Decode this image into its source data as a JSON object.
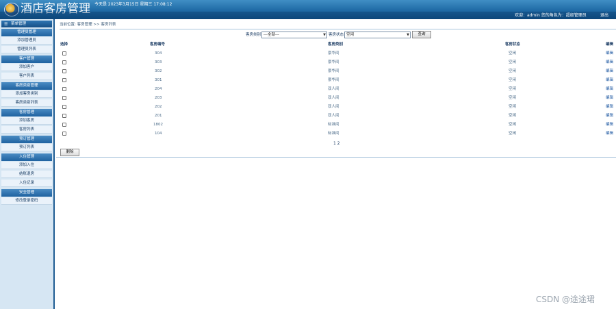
{
  "header": {
    "app_title": "酒店客房管理",
    "date_text": "今天是 2023年3月15日 星期三 17:08:12",
    "user_info": "欢迎：admin  您的角色为：超级管理员",
    "logout_label": "退出"
  },
  "sidebar": {
    "menu_title": "菜单管理",
    "groups": [
      {
        "title": "管理员管理",
        "items": [
          "添加管理员",
          "管理员列表"
        ]
      },
      {
        "title": "客户管理",
        "items": [
          "添加客户",
          "客户列表"
        ]
      },
      {
        "title": "客房类别管理",
        "items": [
          "添加客房类别",
          "客房类别列表"
        ]
      },
      {
        "title": "客房管理",
        "items": [
          "添加客房",
          "客房列表"
        ]
      },
      {
        "title": "预订管理",
        "items": [
          "预订列表"
        ]
      },
      {
        "title": "入住管理",
        "items": [
          "添加入住",
          "结账退房",
          "入住记录"
        ]
      },
      {
        "title": "安全管理",
        "items": [
          "修改登录密码"
        ]
      }
    ]
  },
  "breadcrumb": "当前位置: 客房管理 >> 客房列表",
  "filter": {
    "category_label": "客房类别",
    "category_value": "---全部---",
    "status_label": "客房状态",
    "status_value": "空闲",
    "search_label": "查询"
  },
  "table": {
    "headers": [
      "选择",
      "客房编号",
      "客房类别",
      "客房状态",
      "编辑"
    ],
    "rows": [
      {
        "number": "304",
        "category": "豪华间",
        "status": "空闲",
        "edit": "编辑"
      },
      {
        "number": "303",
        "category": "豪华间",
        "status": "空闲",
        "edit": "编辑"
      },
      {
        "number": "302",
        "category": "豪华间",
        "status": "空闲",
        "edit": "编辑"
      },
      {
        "number": "301",
        "category": "豪华间",
        "status": "空闲",
        "edit": "编辑"
      },
      {
        "number": "204",
        "category": "双人间",
        "status": "空闲",
        "edit": "编辑"
      },
      {
        "number": "203",
        "category": "双人间",
        "status": "空闲",
        "edit": "编辑"
      },
      {
        "number": "202",
        "category": "双人间",
        "status": "空闲",
        "edit": "编辑"
      },
      {
        "number": "201",
        "category": "双人间",
        "status": "空闲",
        "edit": "编辑"
      },
      {
        "number": "1802",
        "category": "标准间",
        "status": "空闲",
        "edit": "编辑"
      },
      {
        "number": "104",
        "category": "标准间",
        "status": "空闲",
        "edit": "编辑"
      }
    ]
  },
  "pager": "1 2",
  "delete_label": "删除",
  "watermark": "CSDN @途途珺"
}
